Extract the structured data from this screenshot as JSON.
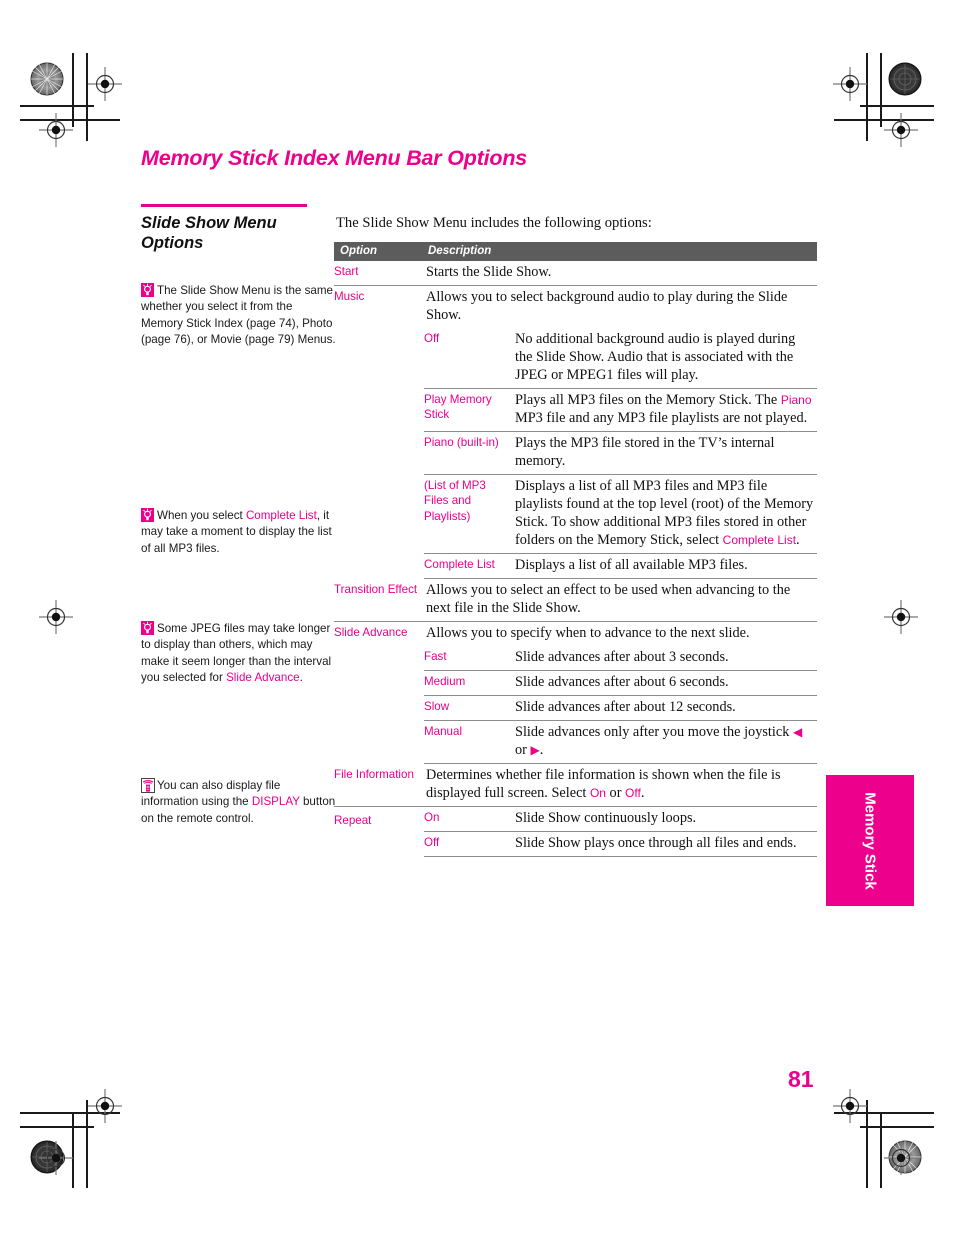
{
  "page": {
    "title": "Memory Stick Index Menu Bar Options",
    "page_number": "81",
    "thumb_tab": "Memory Stick"
  },
  "sidebar": {
    "heading": "Slide Show Menu Options",
    "notes": [
      {
        "icon": "tip-lightbulb-icon",
        "segments": [
          {
            "text": "The Slide Show Menu is the same whether you select it from the Memory Stick Index (page 74), Photo (page 76), or Movie (page 79) Menus.",
            "style": "plain"
          }
        ]
      },
      {
        "icon": "tip-lightbulb-icon",
        "segments": [
          {
            "text": "When you select ",
            "style": "plain"
          },
          {
            "text": "Complete List",
            "style": "magenta"
          },
          {
            "text": ", it may take a moment to display the list of all MP3 files.",
            "style": "plain"
          }
        ]
      },
      {
        "icon": "tip-lightbulb-icon",
        "segments": [
          {
            "text": "Some JPEG files may take longer to display than others, which may make it seem longer than the interval you selected for ",
            "style": "plain"
          },
          {
            "text": "Slide Advance",
            "style": "magenta"
          },
          {
            "text": ".",
            "style": "plain"
          }
        ]
      },
      {
        "icon": "remote-control-icon",
        "segments": [
          {
            "text": "You can also display file information using the ",
            "style": "plain"
          },
          {
            "text": "DISPLAY",
            "style": "magenta"
          },
          {
            "text": " button on the remote control.",
            "style": "plain"
          }
        ]
      }
    ]
  },
  "main": {
    "intro": "The Slide Show Menu includes the following options:",
    "table": {
      "headers": {
        "option": "Option",
        "description": "Description"
      },
      "rows": [
        {
          "option": "Start",
          "description": "Starts the Slide Show.",
          "subrows": []
        },
        {
          "option": "Music",
          "description": "Allows you to select background audio to play during the Slide Show.",
          "subrows": [
            {
              "option": "Off",
              "description": "No additional background audio is played during the Slide Show. Audio that is associated with the JPEG or MPEG1 files will play."
            },
            {
              "option": "Play Memory Stick",
              "description_parts": [
                {
                  "text": "Plays all MP3 files on the Memory Stick. The ",
                  "style": "plain"
                },
                {
                  "text": "Piano",
                  "style": "magenta"
                },
                {
                  "text": " MP3 file and any MP3 file playlists are not played.",
                  "style": "plain"
                }
              ]
            },
            {
              "option": "Piano (built-in)",
              "description": "Plays the MP3 file stored in the TV’s internal memory."
            },
            {
              "option": "(List of MP3 Files and Playlists)",
              "description_parts": [
                {
                  "text": "Displays a list of all MP3 files and MP3 file playlists found at the top level (root) of the Memory Stick. To show additional MP3 files stored in other folders on the Memory Stick, select ",
                  "style": "plain"
                },
                {
                  "text": "Complete List",
                  "style": "magenta"
                },
                {
                  "text": ".",
                  "style": "plain"
                }
              ]
            },
            {
              "option": "Complete List",
              "description": "Displays a list of all available MP3 files."
            }
          ]
        },
        {
          "option": "Transition Effect",
          "description": "Allows you to select an effect to be used when advancing to the next file in the Slide Show.",
          "subrows": []
        },
        {
          "option": "Slide Advance",
          "description": "Allows you to specify when to advance to the next slide.",
          "subrows": [
            {
              "option": "Fast",
              "description": "Slide advances after about 3 seconds."
            },
            {
              "option": "Medium",
              "description": "Slide advances after about 6 seconds."
            },
            {
              "option": "Slow",
              "description": "Slide advances after about 12 seconds."
            },
            {
              "option": "Manual",
              "description_parts": [
                {
                  "text": "Slide advances only after you move the joystick ",
                  "style": "plain"
                },
                {
                  "text": "←",
                  "style": "arrow"
                },
                {
                  "text": " or ",
                  "style": "plain"
                },
                {
                  "text": "→",
                  "style": "arrow"
                },
                {
                  "text": ".",
                  "style": "plain"
                }
              ]
            }
          ]
        },
        {
          "option": "File Information",
          "description_parts": [
            {
              "text": "Determines whether file information is shown when the file is displayed full screen. Select ",
              "style": "plain"
            },
            {
              "text": "On",
              "style": "magenta"
            },
            {
              "text": " or ",
              "style": "plain"
            },
            {
              "text": "Off",
              "style": "magenta"
            },
            {
              "text": ".",
              "style": "plain"
            }
          ],
          "subrows": []
        },
        {
          "option": "Repeat",
          "description": "",
          "subrows": [
            {
              "option": "On",
              "description": "Slide Show continuously loops."
            },
            {
              "option": "Off",
              "description": "Slide Show plays once through all files and ends."
            }
          ]
        }
      ]
    }
  },
  "colors": {
    "accent": "#ec008c",
    "table_header_bg": "#5c5c5c",
    "rule": "#8c8c8c",
    "text": "#111111"
  }
}
